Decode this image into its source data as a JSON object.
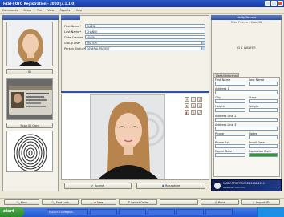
{
  "app": {
    "title": "FAST-FOTO Registration - 2010 [3.1.1.0]"
  },
  "menu": [
    "Commands",
    "Setup",
    "File",
    "View",
    "Reports",
    "Help"
  ],
  "left": {
    "tab_label": "",
    "photo_caption": "ID",
    "scan_caption": "Scan ID Card",
    "fingerprint_caption": ""
  },
  "top_form": {
    "tab_label": "",
    "fields": [
      {
        "label": "First Name*",
        "value": "ELLEN"
      },
      {
        "label": "Last Name*",
        "value": "CHANCE"
      },
      {
        "label": "Date Created",
        "value": "10/15/"
      },
      {
        "label": "Group List*",
        "value": "VISITOR"
      },
      {
        "label": "Person Status*",
        "value": "GENERAL PATIENT"
      }
    ]
  },
  "right": {
    "header": "Verify Record",
    "subheader": "Take Picture / Scan ID",
    "status": "ID 1 LAWYER",
    "tab_label": "Detail Information",
    "rows": [
      {
        "label": "First Name",
        "value": "",
        "label2": "Last Name",
        "value2": ""
      },
      {
        "label": "Address 1",
        "value": "",
        "label2": "",
        "value2": ""
      },
      {
        "label": "City",
        "value": "",
        "label2": "State",
        "value2": ""
      },
      {
        "label": "Height",
        "value": "",
        "label2": "Weight",
        "value2": ""
      },
      {
        "label": "Address Line 2",
        "value": "",
        "label2": "",
        "value2": ""
      },
      {
        "label": "Address Line 3",
        "value": "",
        "label2": "",
        "value2": ""
      },
      {
        "label": "Phone",
        "value": "",
        "label2": "Notes",
        "value2": ""
      },
      {
        "label": "Phone Ext.",
        "value": "",
        "label2": "Email Date",
        "value2": ""
      },
      {
        "label": "Expire Date",
        "value": "",
        "label2": "Expiration Date",
        "value2": ""
      }
    ],
    "badge_line1": "FAST-FOTO PROCESS 2008-2010",
    "badge_line2": "www.fast-foto.com"
  },
  "center": {
    "accept_label": "Accept",
    "recapture_label": "Recapture",
    "tools": [
      "+",
      "-",
      "↺",
      "↻",
      "⊕",
      "⊖",
      "◐",
      "✎",
      "⤢"
    ]
  },
  "bottom": {
    "buttons": [
      "Find",
      "Find Last",
      "New",
      "Select Order",
      "",
      "Print",
      "Import ID"
    ]
  },
  "taskbar": {
    "start_label": "start",
    "tasks": [
      "FAST-FOTO Registr...",
      "",
      "",
      "",
      "",
      ""
    ],
    "clock": ""
  },
  "colors": {
    "accent": "#2f51a4",
    "window": "#ece9d8",
    "titlebar": "#1238a0"
  }
}
